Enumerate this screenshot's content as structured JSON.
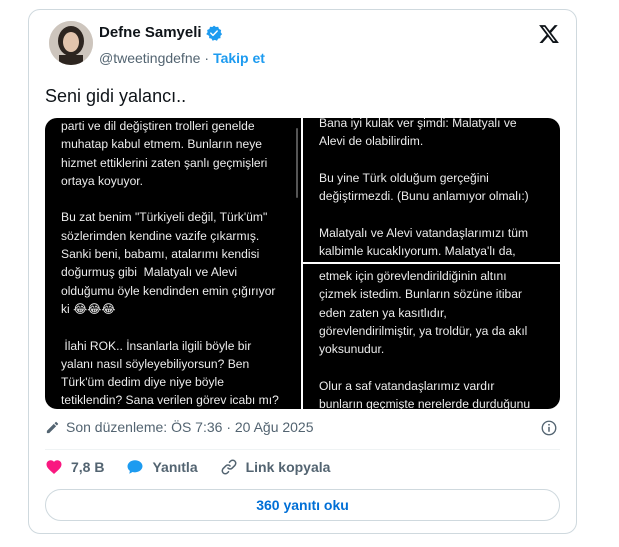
{
  "author": {
    "name": "Defne Samyeli",
    "handle": "@tweetingdefne",
    "separator": "·",
    "follow_label": "Takip et",
    "verified_color": "#1d9bf0"
  },
  "tweet": {
    "text": "Seni gidi yalancı.."
  },
  "media": {
    "left_panel": [
      "parti ve dil değiştiren trolleri genelde",
      "muhatap kabul etmem. Bunların neye",
      "hizmet ettiklerini zaten şanlı geçmişleri",
      "ortaya koyuyor.",
      "",
      "Bu zat benim \"Türkiyeli değil, Türk'üm\"",
      "sözlerimden kendine vazife çıkarmış.",
      "Sanki beni, babamı, atalarımı kendisi",
      "doğurmuş gibi  Malatyalı ve Alevi",
      "olduğumu öyle kendinden emin çığırıyor",
      "ki 😂😂😂",
      "",
      " İlahi ROK.. İnsanlarla ilgili böyle bir",
      "yalanı nasıl söyleyebiliyorsun? Ben",
      "Türk'üm dedim diye niye böyle",
      "tetiklendin? Sana verilen görev icabı mı?"
    ],
    "top_right_panel": [
      "Bana iyi kulak ver şimdi: Malatyalı ve",
      "Alevi de olabilirdim.",
      "",
      "Bu yine Türk olduğum gerçeğini",
      "değiştirmezdi. (Bunu anlamıyor olmalı:)",
      "",
      "Malatyalı ve Alevi vatandaşlarımızı tüm",
      "kalbimle kucaklıyorum. Malatya'lı da,"
    ],
    "bottom_right_panel": [
      "etmek için görevlendirildiğinin altını",
      "çizmek istedim. Bunların sözüne itibar",
      "eden zaten ya kasıtlıdır,",
      "görevlendirilmiştir, ya troldür, ya da akıl",
      "yoksunudur.",
      "",
      "Olur a saf vatandaşlarımız vardır",
      "bunların geçmişte nerelerde durduğunu"
    ]
  },
  "meta": {
    "edited_label": "Son düzenleme: ÖS 7:36 · 20 Ağu 2025"
  },
  "actions": {
    "like_count": "7,8 B",
    "reply_label": "Yanıtla",
    "copy_link_label": "Link kopyala",
    "like_color": "#f91880",
    "reply_color": "#1d9bf0"
  },
  "read_replies": {
    "label": "360 yanıtı oku"
  }
}
